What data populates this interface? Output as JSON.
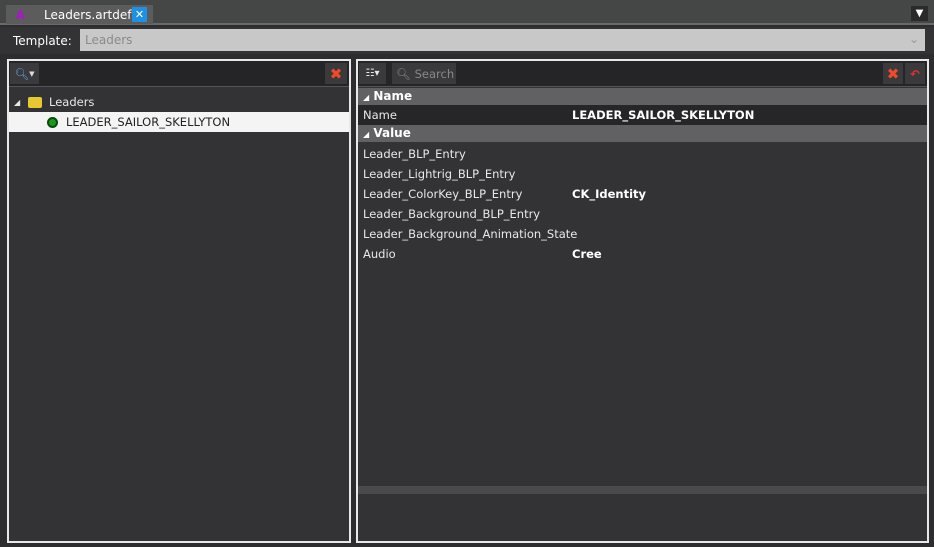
{
  "tab": {
    "logo": "A",
    "title": "Leaders.artdef",
    "close": "✕"
  },
  "template": {
    "label": "Template:",
    "value": "Leaders"
  },
  "tree": {
    "root": "Leaders",
    "items": [
      "LEADER_SAILOR_SKELLYTON"
    ]
  },
  "properties": {
    "search_placeholder": "Search",
    "sections": [
      {
        "title": "Name",
        "rows": [
          {
            "key": "Name",
            "value": "LEADER_SAILOR_SKELLYTON"
          }
        ]
      },
      {
        "title": "Value",
        "rows": [
          {
            "key": "Leader_BLP_Entry",
            "value": ""
          },
          {
            "key": "Leader_Lightrig_BLP_Entry",
            "value": ""
          },
          {
            "key": "Leader_ColorKey_BLP_Entry",
            "value": "CK_Identity"
          },
          {
            "key": "Leader_Background_BLP_Entry",
            "value": ""
          },
          {
            "key": "Leader_Background_Animation_State",
            "value": ""
          },
          {
            "key": "Audio",
            "value": "Cree"
          }
        ]
      }
    ]
  }
}
